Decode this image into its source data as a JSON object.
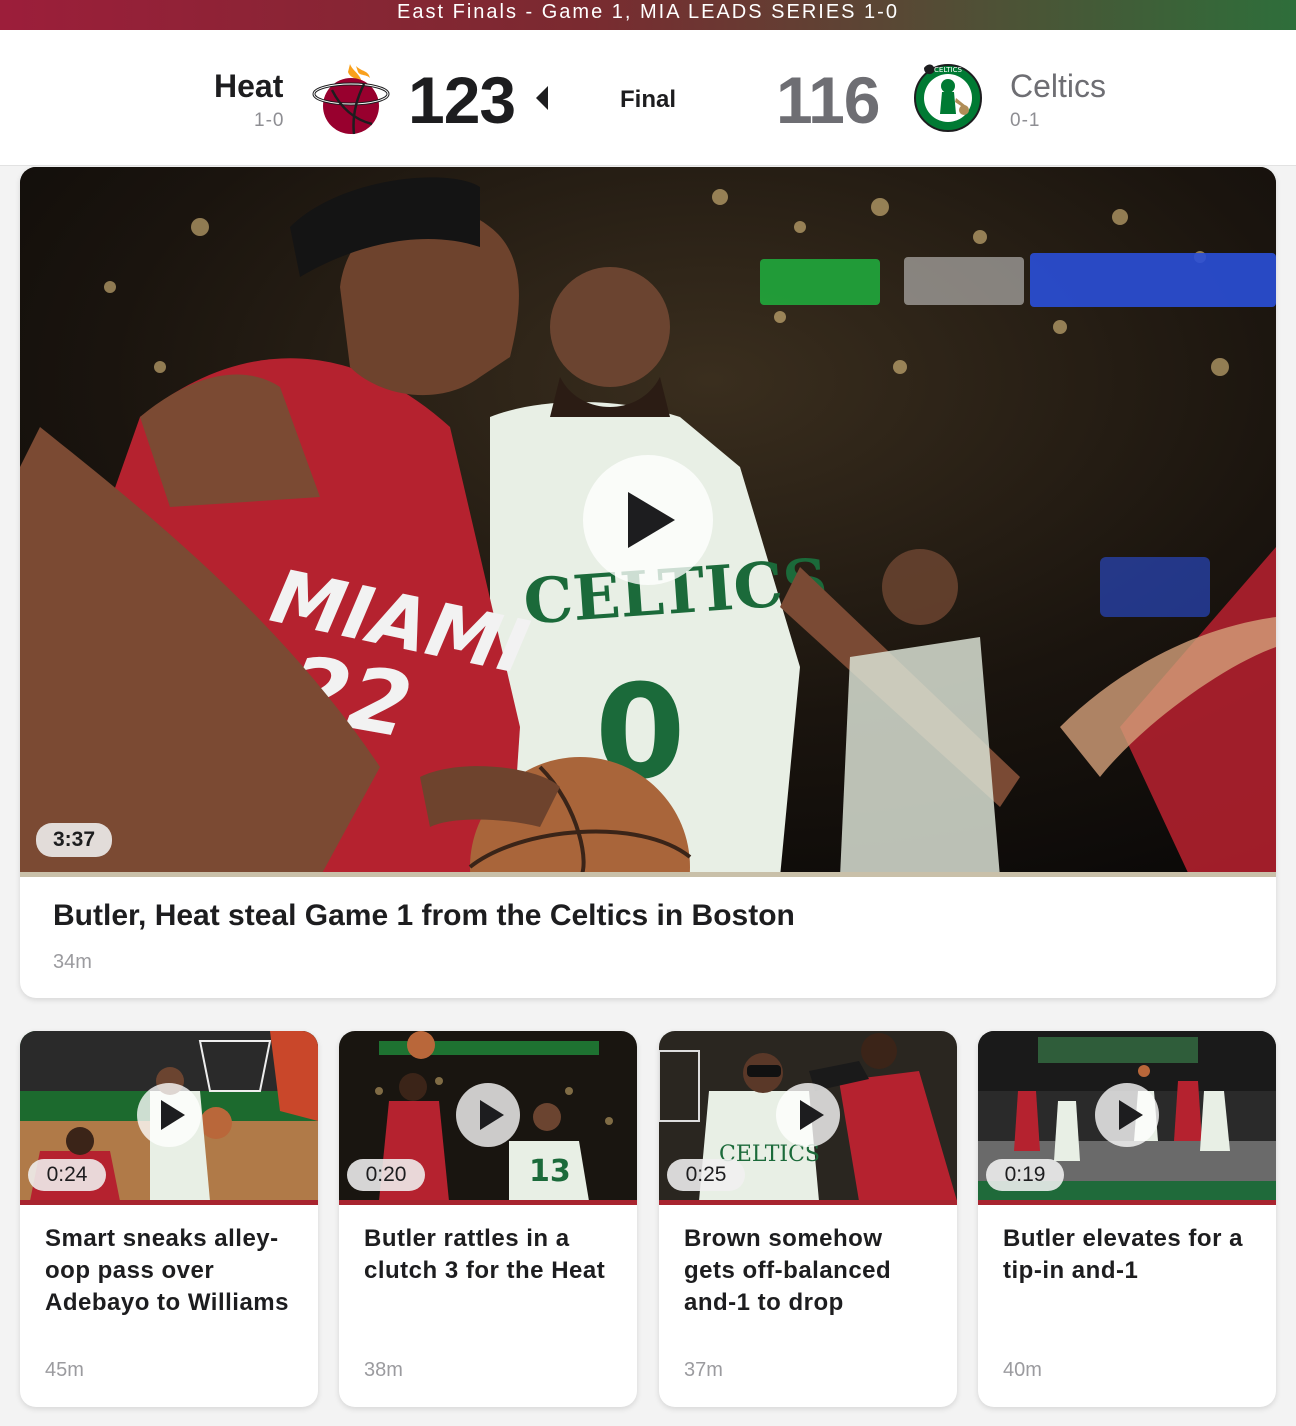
{
  "banner": {
    "text": "East Finals - Game 1, MIA LEADS SERIES 1-0"
  },
  "game": {
    "status": "Final",
    "home": {
      "name": "Heat",
      "record": "1-0",
      "score": "123",
      "logo": "heat-logo",
      "winner": true
    },
    "away": {
      "name": "Celtics",
      "record": "0-1",
      "score": "116",
      "logo": "celtics-logo",
      "winner": false
    }
  },
  "hero": {
    "duration": "3:37",
    "title": "Butler, Heat steal Game 1 from the Celtics in Boston",
    "time": "34m",
    "icon": "play-icon"
  },
  "clips": [
    {
      "duration": "0:24",
      "title": "Smart sneaks alley-oop pass over Adebayo to Williams",
      "time": "45m"
    },
    {
      "duration": "0:20",
      "title": "Butler rattles in a clutch 3 for the Heat",
      "time": "38m"
    },
    {
      "duration": "0:25",
      "title": "Brown somehow gets off-balanced and-1 to drop",
      "time": "37m"
    },
    {
      "duration": "0:19",
      "title": "Butler elevates for a tip-in and-1",
      "time": "40m"
    }
  ],
  "colors": {
    "heat": "#98002e",
    "celtics": "#007a33",
    "accent_strip": "#c9c0a9"
  }
}
